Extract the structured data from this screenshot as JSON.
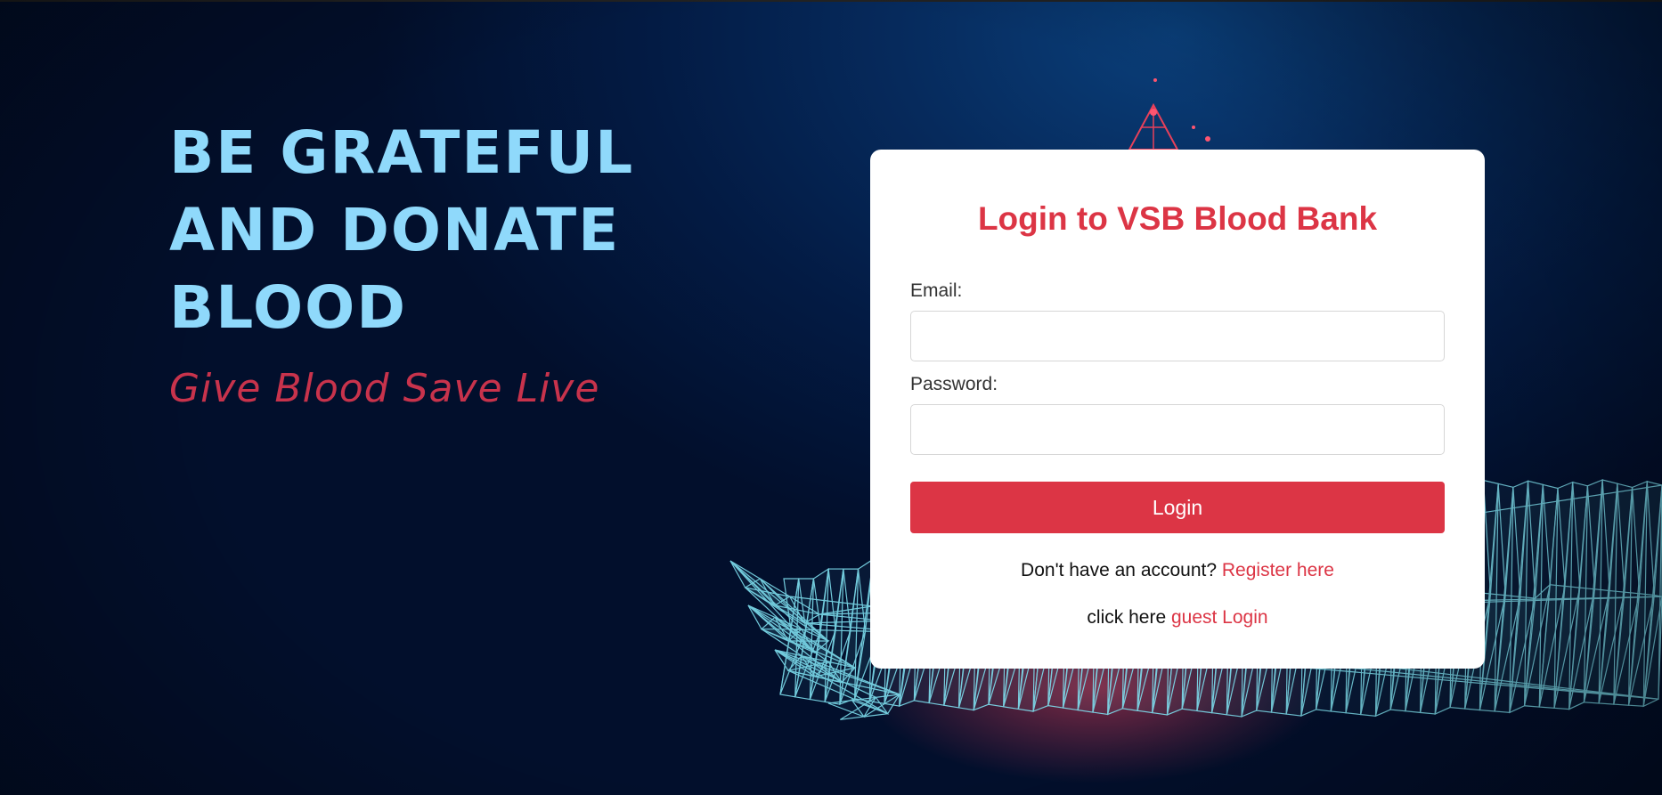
{
  "hero": {
    "headline": [
      "BE GRATEFUL",
      "AND DONATE",
      "BLOOD"
    ],
    "tagline": "Give Blood  Save Live"
  },
  "login": {
    "title": "Login to VSB Blood Bank",
    "email_label": "Email:",
    "email_value": "",
    "password_label": "Password:",
    "password_value": "",
    "button_label": "Login",
    "register_prompt": "Don't have an account?",
    "register_link": "Register here",
    "guest_prompt": "click here",
    "guest_link": "guest Login"
  },
  "colors": {
    "accent": "#dc3545",
    "headline": "#8fd9fb",
    "tagline": "#c8334c",
    "background": "#031b44",
    "wireframe": "#7fe0f0"
  },
  "background_art": {
    "icons": [
      "wireframe-hand-icon",
      "blood-drop-icon"
    ]
  }
}
